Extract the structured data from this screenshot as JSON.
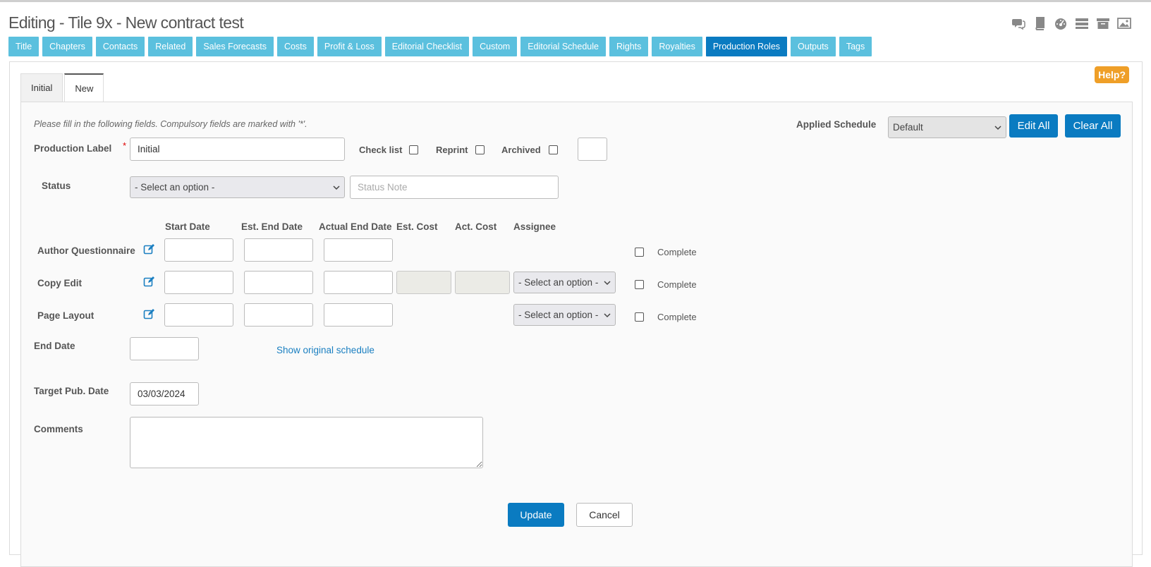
{
  "header": {
    "title": "Editing - Tile 9x - New contract test"
  },
  "top_icons": [
    "comments-icon",
    "book-icon",
    "dashboard-icon",
    "list-icon",
    "archive-icon",
    "image-icon"
  ],
  "nav_tabs": [
    {
      "label": "Title"
    },
    {
      "label": "Chapters"
    },
    {
      "label": "Contacts"
    },
    {
      "label": "Related"
    },
    {
      "label": "Sales Forecasts"
    },
    {
      "label": "Costs"
    },
    {
      "label": "Profit & Loss"
    },
    {
      "label": "Editorial Checklist"
    },
    {
      "label": "Custom"
    },
    {
      "label": "Editorial Schedule"
    },
    {
      "label": "Rights"
    },
    {
      "label": "Royalties"
    },
    {
      "label": "Production Roles",
      "active": true
    },
    {
      "label": "Outputs"
    },
    {
      "label": "Tags"
    }
  ],
  "help_label": "Help?",
  "subtabs": [
    {
      "label": "Initial"
    },
    {
      "label": "New",
      "active": true
    }
  ],
  "form": {
    "intro": "Please fill in the following fields. Compulsory fields are marked with '*'.",
    "applied_schedule_label": "Applied Schedule",
    "applied_schedule_value": "Default",
    "edit_all_label": "Edit All",
    "clear_all_label": "Clear All",
    "production_label": "Production Label",
    "required_mark": "*",
    "production_label_value": "Initial",
    "checklist_label": "Check list",
    "reprint_label": "Reprint",
    "archived_label": "Archived",
    "status_label": "Status",
    "status_select": "- Select an option -",
    "status_note_placeholder": "Status Note",
    "columns": {
      "start_date": "Start Date",
      "est_end_date": "Est. End Date",
      "actual_end_date": "Actual End Date",
      "est_cost": "Est. Cost",
      "act_cost": "Act. Cost",
      "assignee": "Assignee"
    },
    "rows": [
      {
        "name": "Author Questionnaire",
        "assignee": "",
        "complete": "Complete"
      },
      {
        "name": "Copy Edit",
        "assignee": "- Select an option -",
        "complete": "Complete"
      },
      {
        "name": "Page Layout",
        "assignee": "- Select an option -",
        "complete": "Complete"
      }
    ],
    "end_date_label": "End Date",
    "show_original_label": "Show original schedule",
    "target_pub_label": "Target Pub. Date",
    "target_pub_value": "03/03/2024",
    "comments_label": "Comments",
    "update_label": "Update",
    "cancel_label": "Cancel"
  }
}
